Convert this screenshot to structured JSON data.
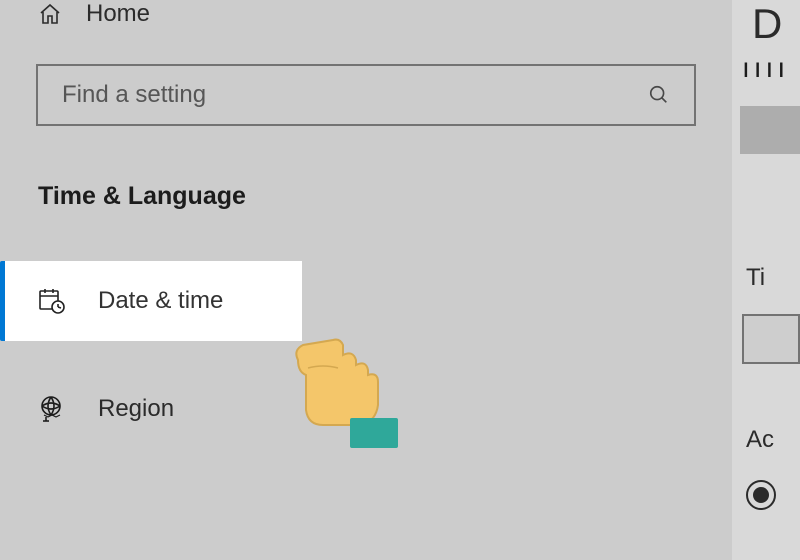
{
  "sidebar": {
    "home_label": "Home",
    "search_placeholder": "Find a setting",
    "section_title": "Time & Language",
    "items": [
      {
        "label": "Date & time",
        "icon": "calendar-clock"
      },
      {
        "label": "Region",
        "icon": "globe"
      }
    ]
  },
  "right": {
    "title_partial": "D",
    "line_partial": "ıııı",
    "label_ti": "Ti",
    "label_ac": "Ac"
  }
}
